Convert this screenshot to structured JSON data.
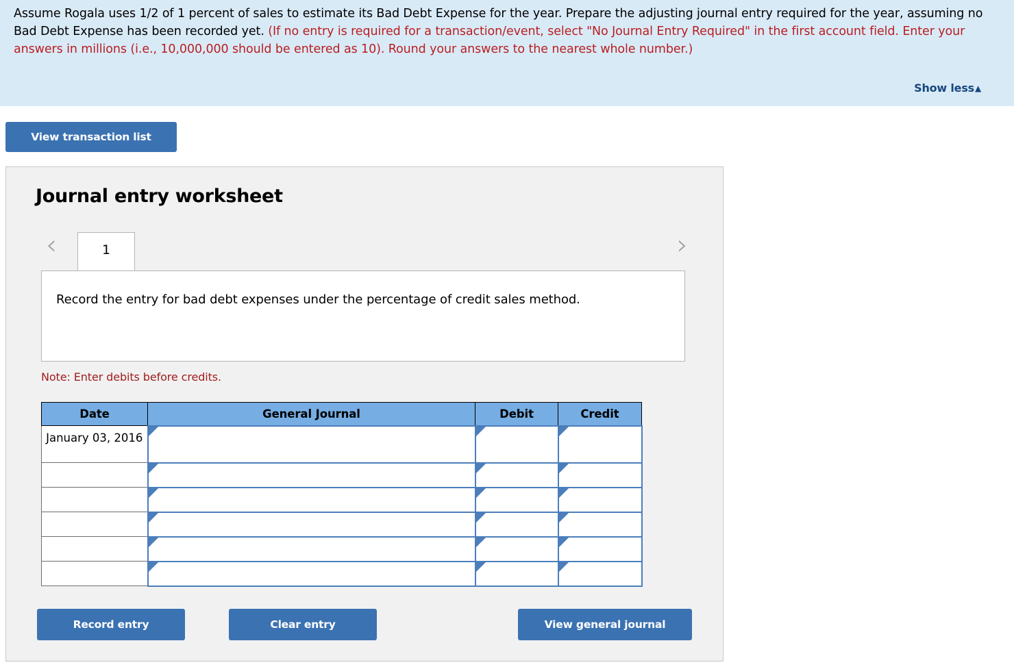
{
  "question": {
    "text_plain_1": "Assume Rogala uses 1/2 of 1 percent of sales to estimate its Bad Debt Expense for the year. Prepare the adjusting journal entry required for the year, assuming no Bad Debt Expense has been recorded yet. ",
    "text_required": "(If no entry is required for a transaction/event, select \"No Journal Entry Required\" in the first account field. Enter your answers in millions (i.e., 10,000,000 should be entered as 10). Round your answers to the nearest whole number.)",
    "show_less_label": "Show less",
    "show_less_caret": "▲"
  },
  "toolbar": {
    "view_transaction_list_label": "View transaction list"
  },
  "worksheet": {
    "title": "Journal entry worksheet",
    "prev_chevron": "‹",
    "next_chevron": "›",
    "tabs": [
      {
        "label": "1",
        "active": true
      }
    ],
    "entry_description": "Record the entry for bad debt expenses under the percentage of credit sales method.",
    "note": "Note: Enter debits before credits.",
    "table": {
      "headers": [
        "Date",
        "General Journal",
        "Debit",
        "Credit"
      ],
      "rows": [
        {
          "date": "January 03, 2016",
          "general_journal": "",
          "debit": "",
          "credit": ""
        },
        {
          "date": "",
          "general_journal": "",
          "debit": "",
          "credit": ""
        },
        {
          "date": "",
          "general_journal": "",
          "debit": "",
          "credit": ""
        },
        {
          "date": "",
          "general_journal": "",
          "debit": "",
          "credit": ""
        },
        {
          "date": "",
          "general_journal": "",
          "debit": "",
          "credit": ""
        },
        {
          "date": "",
          "general_journal": "",
          "debit": "",
          "credit": ""
        }
      ]
    },
    "actions": {
      "record_entry_label": "Record entry",
      "clear_entry_label": "Clear entry",
      "view_general_journal_label": "View general journal"
    }
  },
  "colors": {
    "banner_background": "#d9eaf7",
    "required_text": "#b81f20",
    "note_text": "#a01d1d",
    "button_blue": "#3b72b2",
    "table_header_blue": "#76ade3",
    "input_border_blue": "#4b7ebb",
    "panel_background": "#f1f1f1",
    "link_blue": "#17487e"
  }
}
